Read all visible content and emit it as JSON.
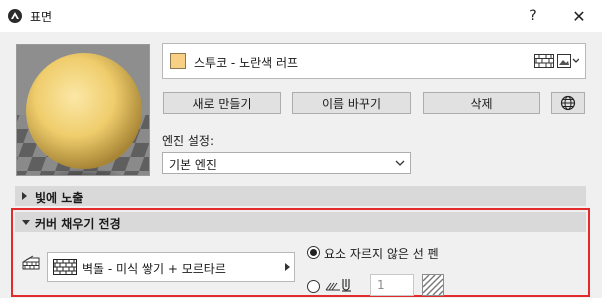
{
  "window": {
    "title": "표면",
    "help_label": "?",
    "close_label": "✕"
  },
  "material": {
    "name": "스투코 - 노란색 러프",
    "swatch_color": "#f7cf85"
  },
  "buttons": {
    "new_label": "새로 만들기",
    "rename_label": "이름 바꾸기",
    "delete_label": "삭제"
  },
  "engine": {
    "label": "엔진 설정:",
    "selected": "기본 엔진"
  },
  "sections": {
    "light_label": "빛에 노출",
    "cover_fill_label": "커버 채우기 전경"
  },
  "cover_fill": {
    "fill_name": "벽돌 - 미식 쌓기 + 모르타르",
    "option_label": "요소 자르지 않은 선 펜",
    "pen_number": "1",
    "option_selected": "요소 자르지 않은 선 펜"
  },
  "colors": {
    "highlight": "#e32b2b",
    "section_header": "#d9d9d9",
    "background": "#f0f0f0"
  }
}
